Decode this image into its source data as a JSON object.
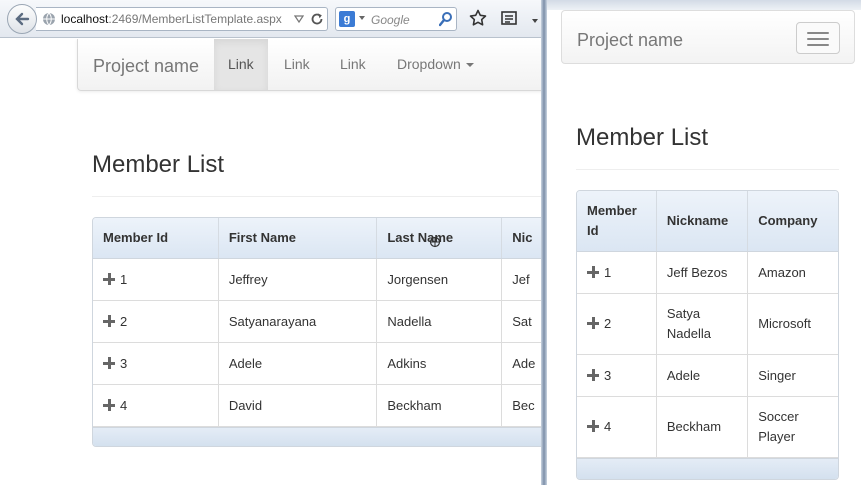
{
  "browser": {
    "url_host": "localhost",
    "url_rest": ":2469/MemberListTemplate.aspx",
    "search_placeholder": "Google"
  },
  "left": {
    "brand": "Project name",
    "nav": [
      {
        "label": "Link",
        "active": true
      },
      {
        "label": "Link"
      },
      {
        "label": "Link"
      },
      {
        "label": "Dropdown"
      }
    ],
    "heading": "Member List",
    "columns": [
      "Member Id",
      "First Name",
      "Last Name",
      "Nic"
    ],
    "rows": [
      [
        "1",
        "Jeffrey",
        "Jorgensen",
        "Jef"
      ],
      [
        "2",
        "Satyanarayana",
        "Nadella",
        "Sat"
      ],
      [
        "3",
        "Adele",
        "Adkins",
        "Ade"
      ],
      [
        "4",
        "David",
        "Beckham",
        "Bec"
      ]
    ]
  },
  "right": {
    "brand": "Project name",
    "heading": "Member List",
    "columns": [
      "Member Id",
      "Nickname",
      "Company"
    ],
    "rows": [
      [
        "1",
        "Jeff Bezos",
        "Amazon"
      ],
      [
        "2",
        "Satya Nadella",
        "Microsoft"
      ],
      [
        "3",
        "Adele",
        "Singer"
      ],
      [
        "4",
        "Beckham",
        "Soccer Player"
      ]
    ]
  },
  "icons": [
    "back-arrow-icon",
    "globe-icon",
    "reload-icon",
    "search-icon",
    "star-icon",
    "reading-list-icon",
    "hamburger-icon",
    "expand-plus-icon"
  ],
  "colors": {
    "table_header_top": "#edf3fa",
    "table_header_bottom": "#dbe6f3",
    "nav_active_bg": "#e5e5e5",
    "brand_text": "#777777"
  }
}
